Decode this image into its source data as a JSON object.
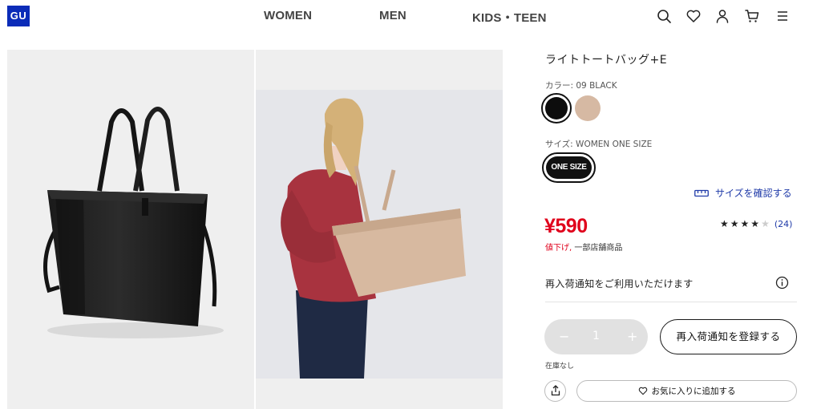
{
  "header": {
    "logo": "GU",
    "nav": [
      "WOMEN",
      "MEN",
      "KIDS・TEEN"
    ],
    "icons": [
      "search-icon",
      "heart-icon",
      "user-icon",
      "cart-icon",
      "menu-icon"
    ]
  },
  "product": {
    "name": "ライトトートバッグ+E",
    "color_label": "カラー: 09 BLACK",
    "colors": [
      {
        "name": "BLACK",
        "hex": "#0d0d0d",
        "selected": true
      },
      {
        "name": "BEIGE",
        "hex": "#d6b9a3",
        "selected": false
      }
    ],
    "size_label": "サイズ: WOMEN ONE SIZE",
    "size_option": "ONE SIZE",
    "size_check_link": "サイズを確認する",
    "price": "¥590",
    "price_note_red": "値下げ,",
    "price_note": "一部店舗商品",
    "rating_stars": 4,
    "rating_max": 5,
    "rating_count": "(24)",
    "restock_message": "再入荷通知をご利用いただけます",
    "quantity": "1",
    "quantity_minus": "−",
    "quantity_plus": "+",
    "notify_button": "再入荷通知を登録する",
    "stock_status": "在庫なし",
    "favorite_button": "お気に入りに追加する"
  },
  "colors": {
    "brand_blue": "#0b2cb8",
    "sale_red": "#e0001b",
    "link_blue": "#1f3aa8"
  }
}
